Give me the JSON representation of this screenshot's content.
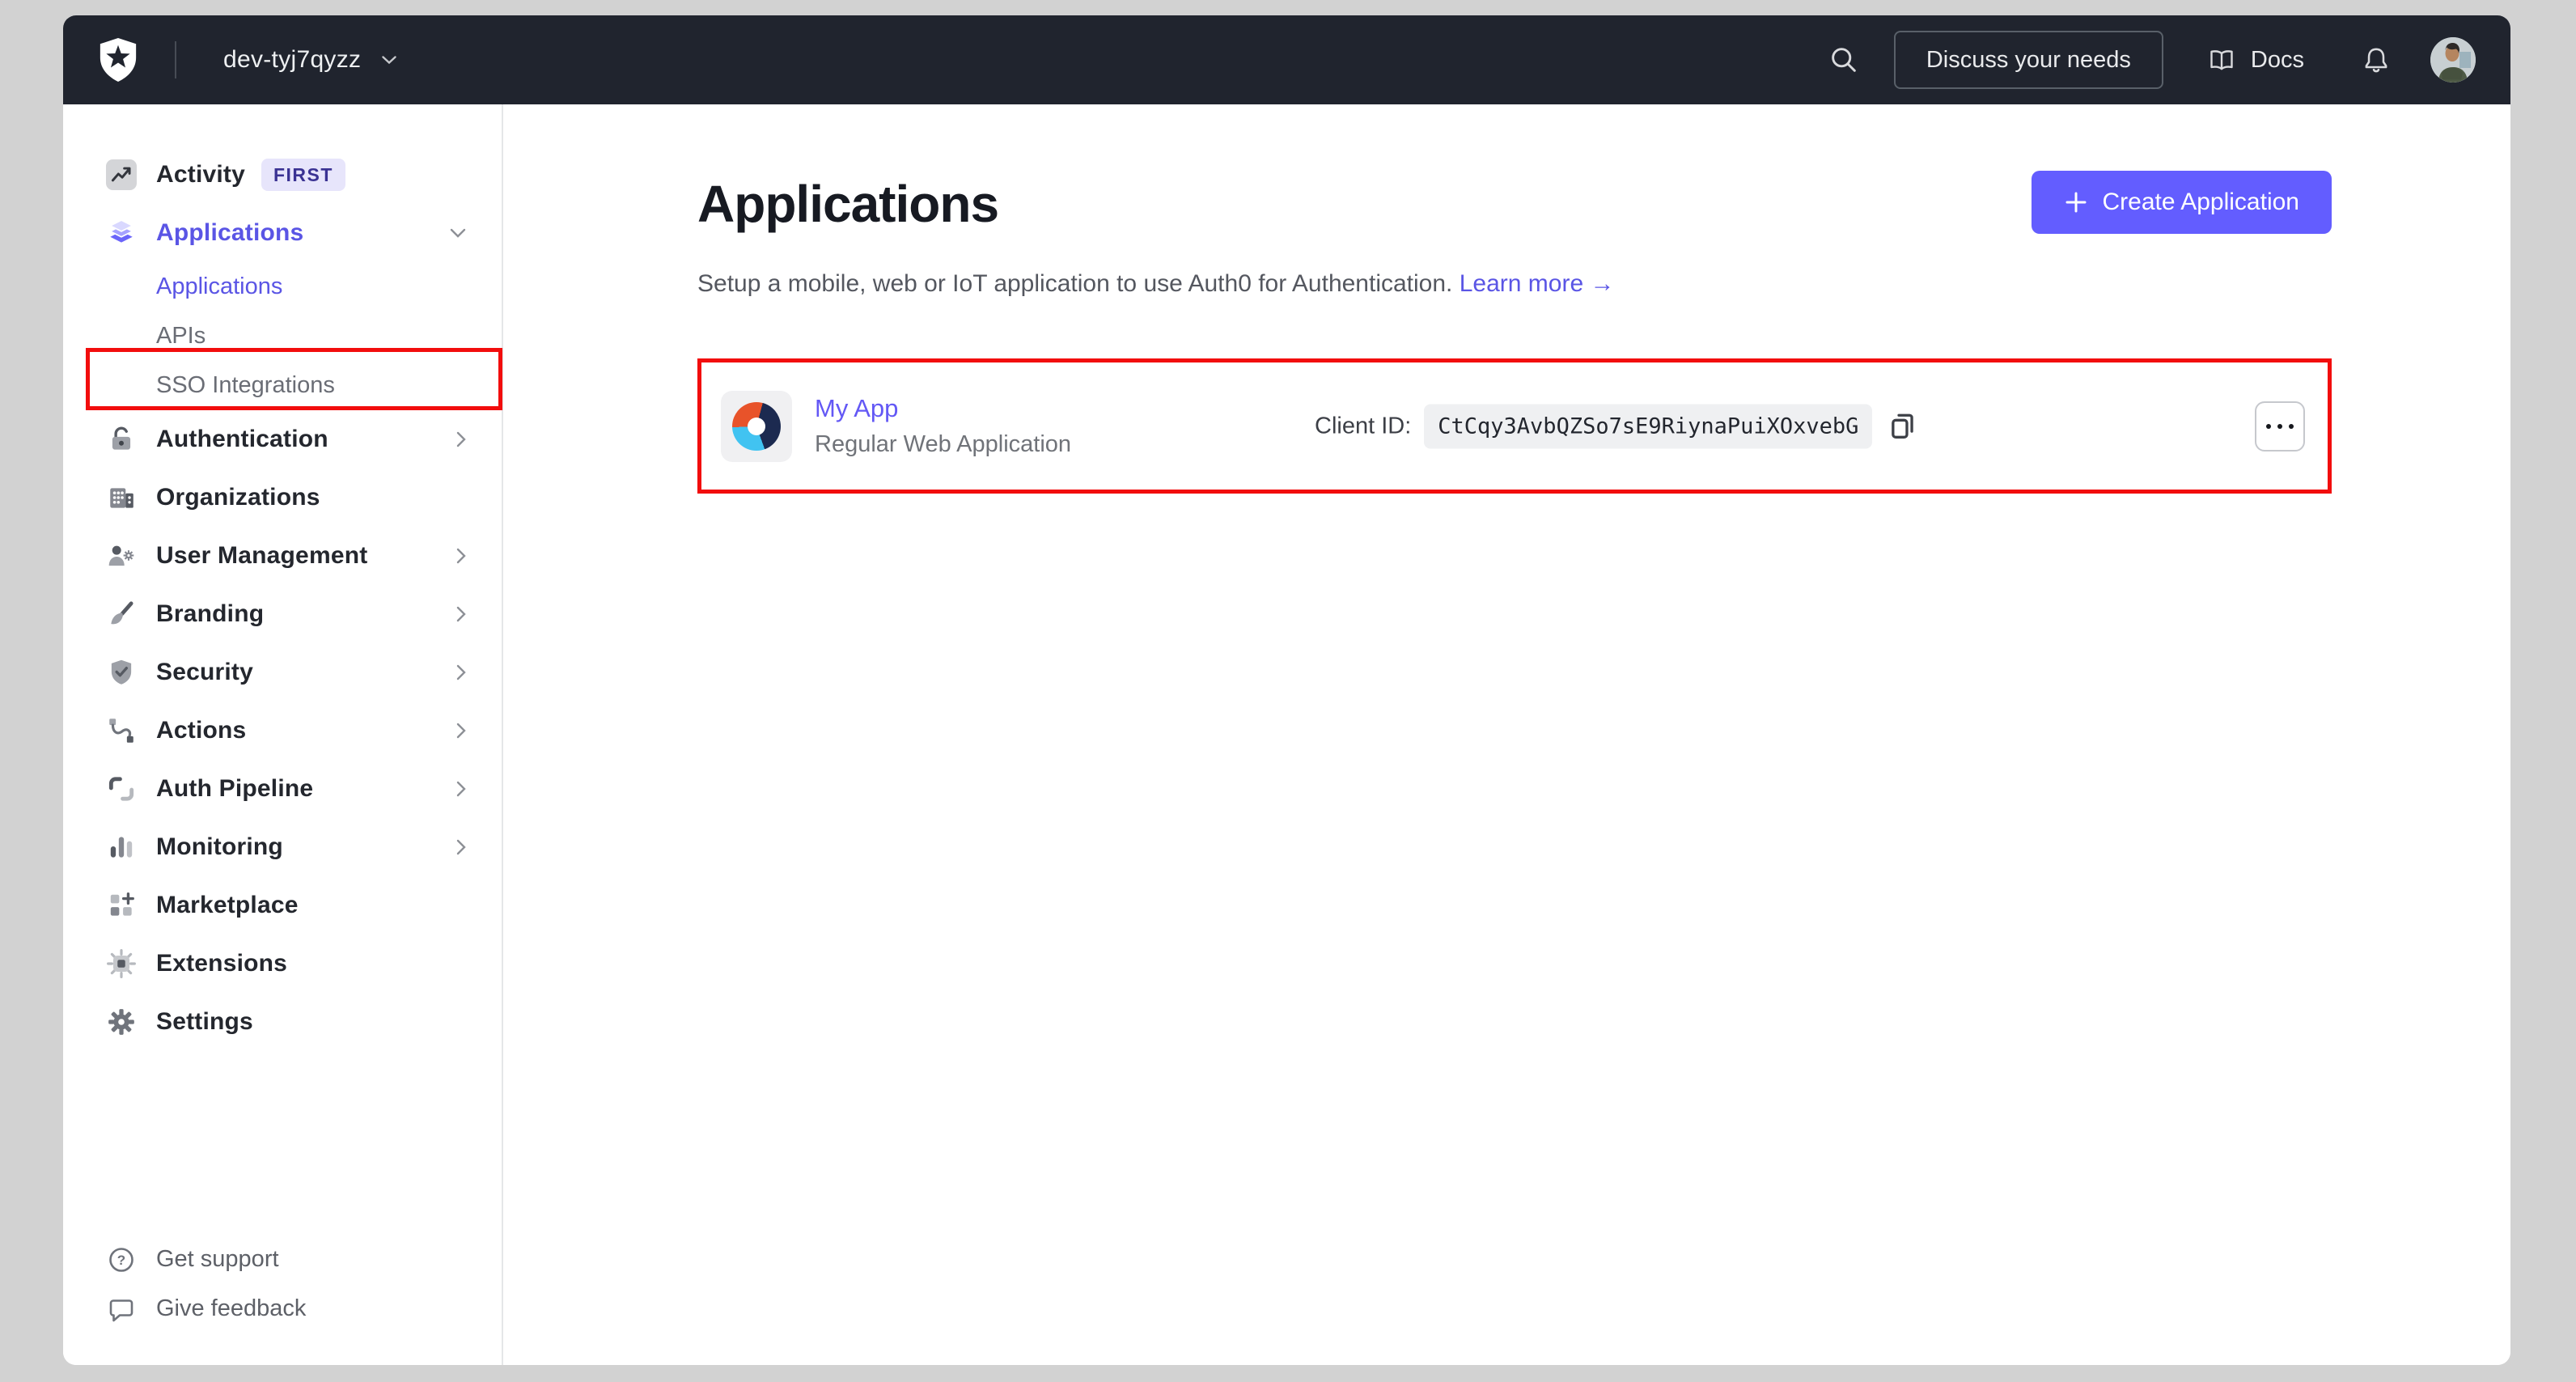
{
  "topbar": {
    "tenant": "dev-tyj7qyzz",
    "discuss_label": "Discuss your needs",
    "docs_label": "Docs"
  },
  "sidebar": {
    "items": [
      {
        "label": "Activity",
        "badge": "FIRST"
      },
      {
        "label": "Applications",
        "children": [
          {
            "label": "Applications"
          },
          {
            "label": "APIs"
          },
          {
            "label": "SSO Integrations"
          }
        ]
      },
      {
        "label": "Authentication"
      },
      {
        "label": "Organizations"
      },
      {
        "label": "User Management"
      },
      {
        "label": "Branding"
      },
      {
        "label": "Security"
      },
      {
        "label": "Actions"
      },
      {
        "label": "Auth Pipeline"
      },
      {
        "label": "Monitoring"
      },
      {
        "label": "Marketplace"
      },
      {
        "label": "Extensions"
      },
      {
        "label": "Settings"
      }
    ],
    "footer_items": [
      {
        "label": "Get support"
      },
      {
        "label": "Give feedback"
      }
    ]
  },
  "main": {
    "title": "Applications",
    "create_button_label": "Create Application",
    "subtitle": "Setup a mobile, web or IoT application to use Auth0 for Authentication.",
    "learn_more_label": "Learn more",
    "learn_more_arrow": "→",
    "app_card": {
      "name": "My App",
      "type": "Regular Web Application",
      "client_id_label": "Client ID:",
      "client_id": "CtCqy3AvbQZSo7sE9RiynaPuiXOxvebG"
    }
  },
  "colors": {
    "accent": "#635dff",
    "topbar_bg": "#20242e",
    "annotation_red": "#f20d0d",
    "link": "#5a55e5"
  }
}
